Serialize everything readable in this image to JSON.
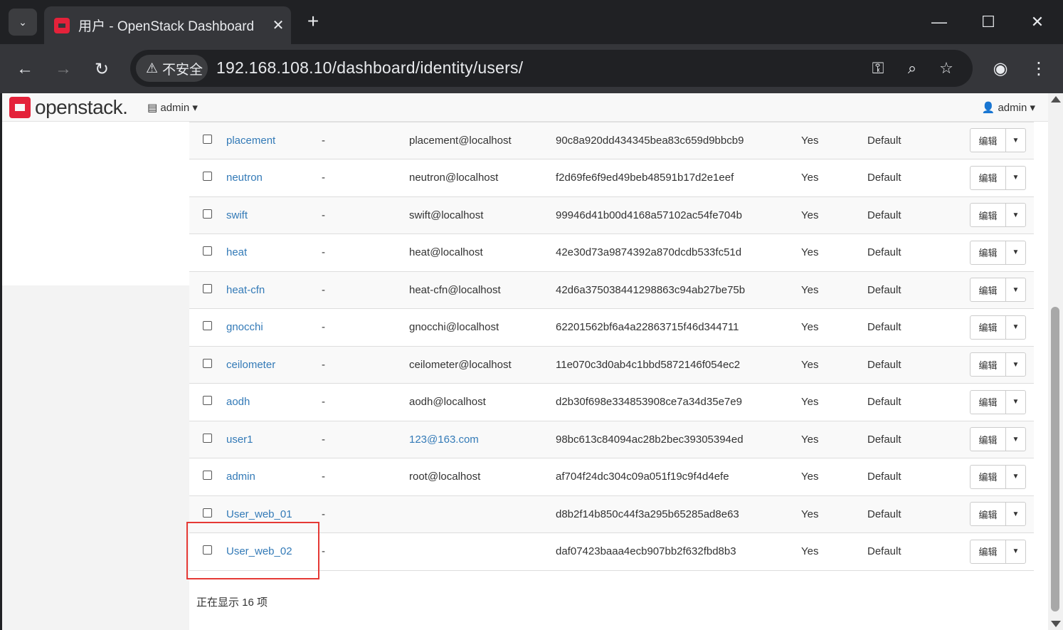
{
  "browser": {
    "tab_title": "用户 - OpenStack Dashboard",
    "tab_close": "✕",
    "new_tab": "+",
    "security_label": "不安全",
    "url": "192.168.108.10/dashboard/identity/users/"
  },
  "app": {
    "logo_text": "openstack.",
    "project_label": "admin",
    "user_label": "admin"
  },
  "table": {
    "edit_label": "编辑",
    "rows": [
      {
        "name": "placement",
        "description": "-",
        "email": "placement@localhost",
        "email_link": false,
        "id": "90c8a920dd434345bea83c659d9bbcb9",
        "enabled": "Yes",
        "domain": "Default"
      },
      {
        "name": "neutron",
        "description": "-",
        "email": "neutron@localhost",
        "email_link": false,
        "id": "f2d69fe6f9ed49beb48591b17d2e1eef",
        "enabled": "Yes",
        "domain": "Default"
      },
      {
        "name": "swift",
        "description": "-",
        "email": "swift@localhost",
        "email_link": false,
        "id": "99946d41b00d4168a57102ac54fe704b",
        "enabled": "Yes",
        "domain": "Default"
      },
      {
        "name": "heat",
        "description": "-",
        "email": "heat@localhost",
        "email_link": false,
        "id": "42e30d73a9874392a870dcdb533fc51d",
        "enabled": "Yes",
        "domain": "Default"
      },
      {
        "name": "heat-cfn",
        "description": "-",
        "email": "heat-cfn@localhost",
        "email_link": false,
        "id": "42d6a375038441298863c94ab27be75b",
        "enabled": "Yes",
        "domain": "Default"
      },
      {
        "name": "gnocchi",
        "description": "-",
        "email": "gnocchi@localhost",
        "email_link": false,
        "id": "62201562bf6a4a22863715f46d344711",
        "enabled": "Yes",
        "domain": "Default"
      },
      {
        "name": "ceilometer",
        "description": "-",
        "email": "ceilometer@localhost",
        "email_link": false,
        "id": "11e070c3d0ab4c1bbd5872146f054ec2",
        "enabled": "Yes",
        "domain": "Default"
      },
      {
        "name": "aodh",
        "description": "-",
        "email": "aodh@localhost",
        "email_link": false,
        "id": "d2b30f698e334853908ce7a34d35e7e9",
        "enabled": "Yes",
        "domain": "Default"
      },
      {
        "name": "user1",
        "description": "-",
        "email": "123@163.com",
        "email_link": true,
        "id": "98bc613c84094ac28b2bec39305394ed",
        "enabled": "Yes",
        "domain": "Default"
      },
      {
        "name": "admin",
        "description": "-",
        "email": "root@localhost",
        "email_link": false,
        "id": "af704f24dc304c09a051f19c9f4d4efe",
        "enabled": "Yes",
        "domain": "Default"
      },
      {
        "name": "User_web_01",
        "description": "-",
        "email": "",
        "email_link": false,
        "id": "d8b2f14b850c44f3a295b65285ad8e63",
        "enabled": "Yes",
        "domain": "Default"
      },
      {
        "name": "User_web_02",
        "description": "-",
        "email": "",
        "email_link": false,
        "id": "daf07423baaa4ecb907bb2f632fbd8b3",
        "enabled": "Yes",
        "domain": "Default"
      }
    ],
    "footer": "正在显示 16 项"
  },
  "colors": {
    "link": "#337ab7",
    "highlight": "#e53935",
    "openstack_red": "#e4223a"
  }
}
